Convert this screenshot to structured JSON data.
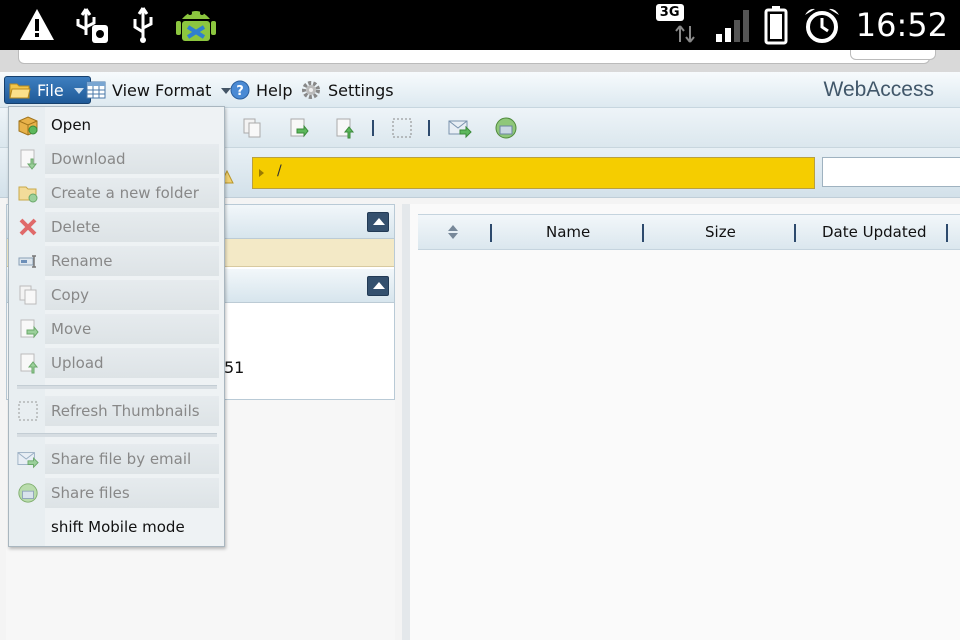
{
  "status_bar": {
    "time": "16:52",
    "network_badge": "3G",
    "icons": [
      "warning-icon",
      "usb-storage-icon",
      "usb-icon",
      "android-debug-icon",
      "data-transfer-icon",
      "signal-icon",
      "battery-icon",
      "alarm-icon"
    ]
  },
  "menubar": {
    "file_label": "File",
    "view_format_label": "View Format",
    "help_label": "Help",
    "settings_label": "Settings",
    "brand": "WebAccess"
  },
  "path": {
    "current": "/"
  },
  "file_table": {
    "columns": [
      "Name",
      "Size",
      "Date Updated"
    ]
  },
  "left_panel": {
    "partial_text": "51"
  },
  "file_menu": {
    "items": [
      {
        "label": "Open",
        "enabled": true,
        "icon": "open-box-icon"
      },
      {
        "label": "Download",
        "enabled": false,
        "icon": "download-icon"
      },
      {
        "label": "Create a new folder",
        "enabled": false,
        "icon": "new-folder-icon"
      },
      {
        "label": "Delete",
        "enabled": false,
        "icon": "delete-icon"
      },
      {
        "label": "Rename",
        "enabled": false,
        "icon": "rename-icon"
      },
      {
        "label": "Copy",
        "enabled": false,
        "icon": "copy-icon"
      },
      {
        "label": "Move",
        "enabled": false,
        "icon": "move-icon"
      },
      {
        "label": "Upload",
        "enabled": false,
        "icon": "upload-icon"
      },
      {
        "label": "Refresh Thumbnails",
        "enabled": false,
        "icon": "refresh-thumbnails-icon"
      },
      {
        "label": "Share file by email",
        "enabled": false,
        "icon": "email-share-icon"
      },
      {
        "label": "Share files",
        "enabled": false,
        "icon": "share-files-icon"
      },
      {
        "label": "shift Mobile mode",
        "enabled": true,
        "icon": ""
      }
    ]
  },
  "colors": {
    "accent": "#1f5a98",
    "path_bar": "#f5cd00",
    "brand_text": "#41576a"
  }
}
